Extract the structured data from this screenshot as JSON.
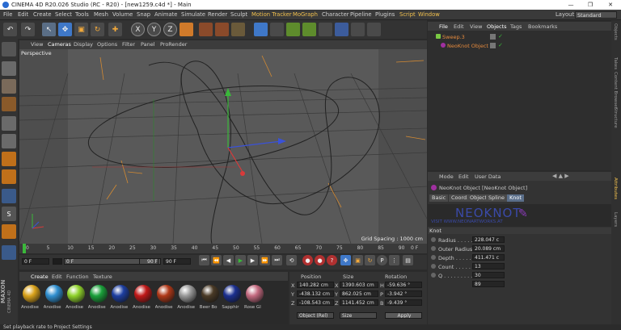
{
  "titlebar": {
    "title": "CINEMA 4D R20.026 Studio (RC - R20) - [new1259.c4d *] - Main",
    "minimize": "—",
    "maximize": "❐",
    "close": "✕"
  },
  "menu": [
    "File",
    "Edit",
    "Create",
    "Select",
    "Tools",
    "Mesh",
    "Volume",
    "Snap",
    "Animate",
    "Simulate",
    "Render",
    "Sculpt",
    "Motion Tracker",
    "MoGraph",
    "Character",
    "Pipeline",
    "Plugins",
    "Script",
    "Window"
  ],
  "layout": {
    "label": "Layout:",
    "value": "Standard"
  },
  "toolbar_icons": {
    "undo": "↶",
    "redo": "↷",
    "pointer": "↖",
    "move": "✥",
    "scale": "▣",
    "rotate": "↻",
    "plus": "✚",
    "x": "X",
    "y": "Y",
    "z": "Z",
    "coord": "⬛"
  },
  "viewport": {
    "menu": [
      "View",
      "Cameras",
      "Display",
      "Options",
      "Filter",
      "Panel",
      "ProRender"
    ],
    "label": "Perspective",
    "grid_spacing": "Grid Spacing : 1000 cm"
  },
  "timeline": {
    "ticks": [
      "0",
      "5",
      "10",
      "15",
      "20",
      "25",
      "30",
      "35",
      "40",
      "45",
      "50",
      "55",
      "60",
      "65",
      "70",
      "75",
      "80",
      "85",
      "90"
    ],
    "end": "0 F"
  },
  "transport": {
    "start": "0 F",
    "cur": "0 F",
    "end1": "90 F",
    "end2": "90 F"
  },
  "materials": {
    "menu": [
      "Create",
      "Edit",
      "Function",
      "Texture"
    ],
    "items": [
      {
        "name": "Anodise",
        "color": "#d9a21b"
      },
      {
        "name": "Anodise",
        "color": "#2f8fd0"
      },
      {
        "name": "Anodise",
        "color": "#8fd22a"
      },
      {
        "name": "Anodise",
        "color": "#1aa03a"
      },
      {
        "name": "Anodise",
        "color": "#1d3ea0"
      },
      {
        "name": "Anodise",
        "color": "#c01818"
      },
      {
        "name": "Anodise",
        "color": "#b03818"
      },
      {
        "name": "Anodise",
        "color": "#999999"
      },
      {
        "name": "Beer Bo",
        "color": "#4a3a26"
      },
      {
        "name": "Sapphir",
        "color": "#1b2f8f"
      },
      {
        "name": "Rose Gl",
        "color": "#c46a80"
      }
    ]
  },
  "coords": {
    "headers": [
      "Position",
      "Size",
      "Rotation"
    ],
    "rows": [
      {
        "axis": "X",
        "pos": "140.282 cm",
        "size": "1390.603 cm",
        "rlabel": "H",
        "rot": "-59.636 °"
      },
      {
        "axis": "Y",
        "pos": "-438.132 cm",
        "size": "862.025 cm",
        "rlabel": "P",
        "rot": "-3.942 °"
      },
      {
        "axis": "Z",
        "pos": "-108.543 cm",
        "size": "1141.452 cm",
        "rlabel": "B",
        "rot": "-9.439 °"
      }
    ],
    "mode": "Object (Rel)",
    "sizemode": "Size",
    "apply": "Apply"
  },
  "objects": {
    "menu": [
      "File",
      "Edit",
      "View",
      "Objects",
      "Tags",
      "Bookmarks"
    ],
    "items": [
      {
        "name": "Sweep.3",
        "color": "#e58a3d"
      },
      {
        "name": "NeoKnot Object",
        "color": "#e58a3d"
      }
    ]
  },
  "attributes": {
    "menu": [
      "Mode",
      "Edit",
      "User Data"
    ],
    "title": "NeoKnot Object [NeoKnot Object]",
    "tabs": [
      "Basic",
      "Coord.",
      "Object",
      "Spline",
      "Knot"
    ],
    "banner": "NEOKNOT",
    "banner_sub": "VISIT WWW.NEONARTWORKS.AT",
    "section": "Knot",
    "fields": [
      {
        "label": "Radius . . . . . .",
        "value": "228.047 c"
      },
      {
        "label": "Outer Radius",
        "value": "20.089 cm"
      },
      {
        "label": "Depth . . . . . . .",
        "value": "411.471 c"
      },
      {
        "label": "Count . . . . . . .",
        "value": "13"
      },
      {
        "label": "Q . . . . . . . . . .",
        "value": "30"
      },
      {
        "label": "",
        "value": "89"
      }
    ]
  },
  "right_tabs": [
    "Objects",
    "Takes",
    "Content Browser",
    "Structure",
    "Attributes",
    "Layers"
  ],
  "status": "Set playback rate to Project Settings",
  "maxon": {
    "line1": "MAXON",
    "line2": "CINEMA 4D"
  }
}
